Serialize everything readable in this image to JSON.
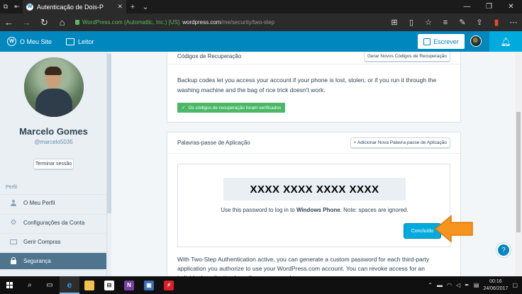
{
  "browser": {
    "tab_title": "Autenticação de Dois-P",
    "tab_close": "✕",
    "new_tab": "+",
    "tab_menu": "⌄",
    "cert_label": "WordPress.com (Automattic, Inc.) [US]",
    "url_host": "wordpress.com",
    "url_path": "/me/security/two-step",
    "window_controls": [
      "—",
      "❐",
      "✕"
    ]
  },
  "masterbar": {
    "my_site": "O Meu Site",
    "reader": "Leitor",
    "write": "Escrever"
  },
  "sidebar": {
    "name": "Marcelo Gomes",
    "username": "@marcelo5035",
    "logout": "Terminar sessão",
    "section_heading": "Perfil",
    "items": [
      {
        "label": "O Meu Perfil"
      },
      {
        "label": "Configurações da Conta"
      },
      {
        "label": "Gerir Compras"
      },
      {
        "label": "Segurança"
      }
    ]
  },
  "recovery_card": {
    "title": "Códigos de Recuperação",
    "generate_button": "Gerar Novos Códigos de Recuperação",
    "body": "Backup codes let you access your account if your phone is lost, stolen, or if you run it through the washing machine and the bag of rice trick doesn't work.",
    "notice": "Os códigos de recuperação foram verificados"
  },
  "app_passwords_card": {
    "title": "Palavras-passe de Aplicação",
    "add_button": "+ Adicionar Nova Palavra-passe de Aplicação",
    "password": "XXXX XXXX XXXX XXXX",
    "help_prefix": "Use this password to log in to ",
    "help_app": "Windows Phone",
    "help_suffix": ". Note: spaces are ignored.",
    "done_button": "Concluído",
    "description": "With Two-Step Authentication active, you can generate a custom password for each third-party application you authorize to use your WordPress.com account. You can revoke access for an individual application here if you ever need to."
  },
  "taskbar": {
    "time": "00:16",
    "date": "24/06/2017"
  },
  "colors": {
    "wp_blue": "#0087be",
    "wp_light_blue": "#00aadc",
    "success_green": "#4ab866",
    "active_nav": "#4f748e",
    "arrow_orange": "#f7941d"
  }
}
